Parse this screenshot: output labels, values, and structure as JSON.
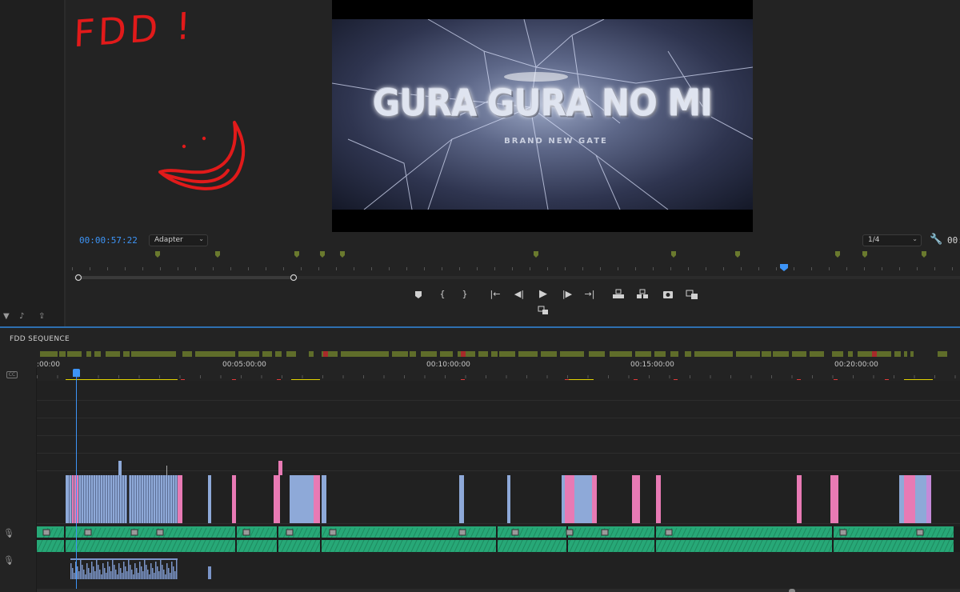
{
  "monitor": {
    "video_title": "GURA GURA NO MI",
    "video_subtitle": "BRAND NEW GATE",
    "timecode": "00:00:57:22",
    "fit_select": "Adapter",
    "resolution_select": "1/4",
    "right_timecode": "00:"
  },
  "annotation": {
    "text": "FDD !"
  },
  "transport": {
    "marker_icon": "marker-icon",
    "in_icon": "mark-in-icon",
    "out_icon": "mark-out-icon",
    "go_in_icon": "go-to-in-icon",
    "step_back_icon": "step-back-icon",
    "play_icon": "play-icon",
    "step_fwd_icon": "step-forward-icon",
    "go_out_icon": "go-to-out-icon",
    "lift_icon": "lift-icon",
    "extract_icon": "extract-icon",
    "camera_icon": "export-frame-icon",
    "compare_icon": "comparison-view-icon",
    "extra_icon": "insert-icon"
  },
  "timeline": {
    "sequence_name": "FDD SEQUENCE",
    "ruler_labels": [
      ":00:00",
      "00:05:00:00",
      "00:10:00:00",
      "00:15:00:00",
      "00:20:00:00"
    ]
  },
  "colors": {
    "accent": "#3d94f6",
    "annotation": "#e11a1a",
    "audio_clip": "#2fc28c",
    "video_clip_blue": "#8ea9d8",
    "video_clip_pink": "#e87ab4",
    "marker_green": "#6a7a2e"
  }
}
